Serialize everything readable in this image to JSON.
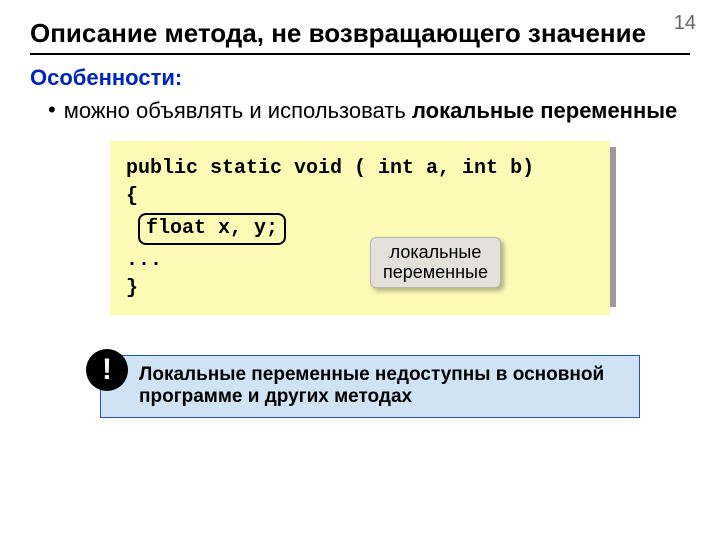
{
  "page_number": "14",
  "title": "Описание метода, не возвращающего значение",
  "subtitle": "Особенности:",
  "bullet": {
    "lead": "можно объявлять и использовать ",
    "bold": "локальные переменные"
  },
  "code": {
    "line1": "public static void ( int a, int b)",
    "line2": "{",
    "local_decl": "float x, y;",
    "line4": "...",
    "line5": "}"
  },
  "callout": {
    "line1": "локальные",
    "line2": "переменные"
  },
  "note": {
    "excl": "!",
    "text": "Локальные переменные недоступны в основной программе и других методах"
  }
}
